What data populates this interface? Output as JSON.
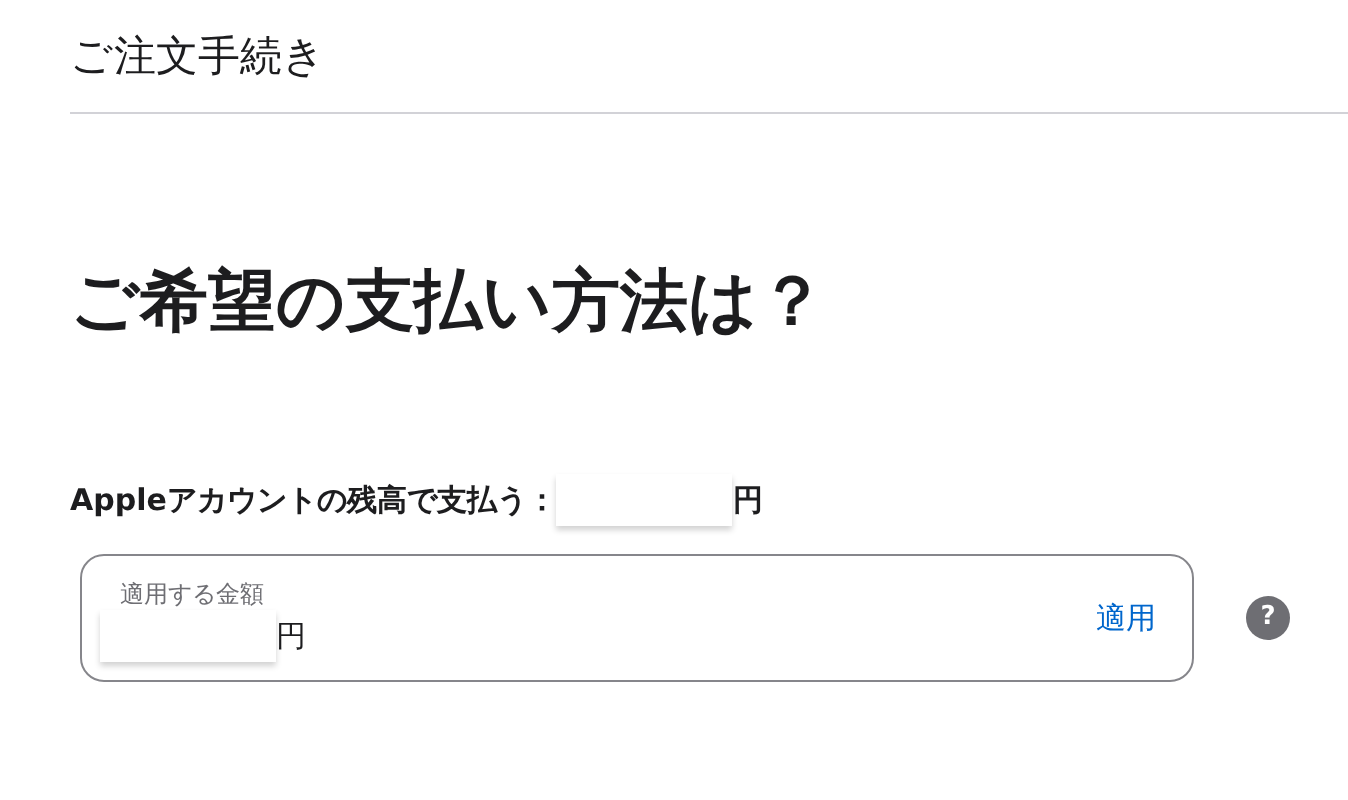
{
  "header": {
    "title": "ご注文手続き"
  },
  "heading": "ご希望の支払い方法は？",
  "balance": {
    "label": "Appleアカウントの残高で支払う：",
    "currency": "円"
  },
  "amount_field": {
    "label": "適用する金額",
    "currency": "円",
    "action": "適用"
  },
  "help_button": "?"
}
